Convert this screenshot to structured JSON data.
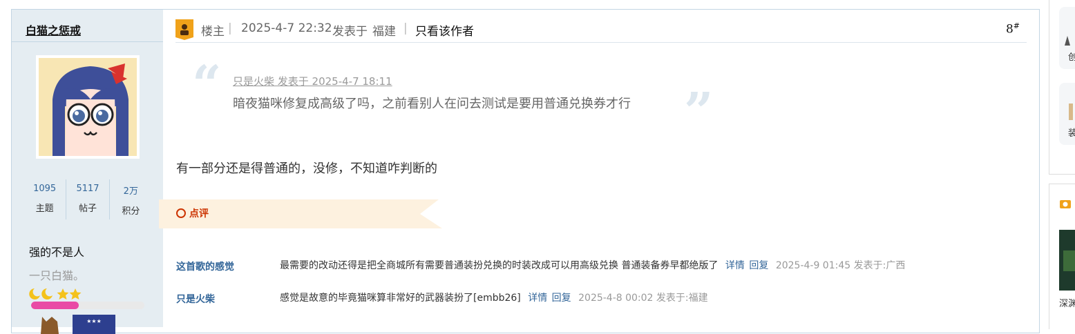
{
  "user": {
    "name": "白猫之惩戒",
    "stats": [
      {
        "value": "1095",
        "label": "主题"
      },
      {
        "value": "5117",
        "label": "帖子"
      },
      {
        "value": "2万",
        "label": "积分"
      }
    ],
    "title": "强的不是人",
    "desc": "一只白猫。",
    "stars": "🌙🌙⭐⭐",
    "level_progress": 0.42,
    "pink": "#e94aa5"
  },
  "post": {
    "op_label": "楼主",
    "datetime": "2025-4-7 22:32",
    "posted_at_label": "发表于",
    "location": "福建",
    "only_author": "只看该作者",
    "floor": "8",
    "floor_mark": "#",
    "quote": {
      "meta": "只是火柴 发表于 2025-4-7 18:11",
      "text": "暗夜猫咪修复成高级了吗，之前看别人在问去测试是要用普通兑换券才行"
    },
    "body": "有一部分还是得普通的，没修，不知道咋判断的"
  },
  "comments_section": {
    "label": "点评",
    "items": [
      {
        "user": "这首歌的感觉",
        "text": "最需要的改动还得是把全商城所有需要普通装扮兑换的时装改成可以用高级兑换 普通装备券早都绝版了",
        "detail": "详情",
        "reply": "回复",
        "meta": "2025-4-9 01:45 发表于:广西"
      },
      {
        "user": "只是火柴",
        "text": "感觉是故意的毕竟猫咪算非常好的武器装扮了[embb26]",
        "detail": "详情",
        "reply": "回复",
        "meta": "2025-4-8 00:02 发表于:福建"
      }
    ]
  },
  "sidebar": {
    "card1_char": "创",
    "card2_char": "装",
    "section_label": "深渊"
  },
  "colors": {
    "link": "#336699",
    "accent_red": "#cc3300",
    "user_bg": "#e5edf2",
    "border": "#c2d5e3"
  }
}
